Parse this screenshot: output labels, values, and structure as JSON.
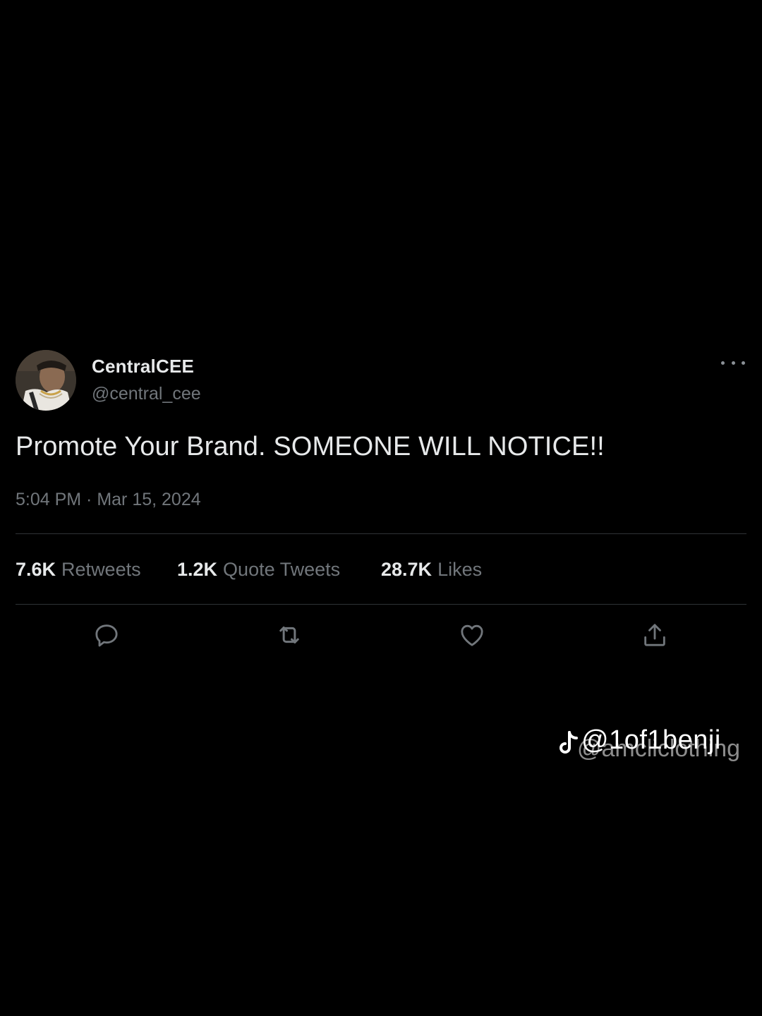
{
  "tweet": {
    "display_name": "CentralCEE",
    "handle": "@central_cee",
    "text": "Promote Your Brand. SOMEONE WILL NOTICE!!",
    "timestamp": "5:04 PM · Mar 15, 2024",
    "stats": {
      "retweets_count": "7.6K",
      "retweets_label": "Retweets",
      "quotes_count": "1.2K",
      "quotes_label": "Quote Tweets",
      "likes_count": "28.7K",
      "likes_label": "Likes"
    },
    "actions": {
      "reply_icon": "speech-bubble-icon",
      "retweet_icon": "retweet-arrows-icon",
      "like_icon": "heart-icon",
      "share_icon": "share-upload-icon"
    },
    "more_icon": "ellipsis-icon"
  },
  "watermark": {
    "primary": "@1of1benji",
    "secondary": "@amcliclothing",
    "logo_icon": "tiktok-logo-icon"
  },
  "colors": {
    "background": "#000000",
    "primary_text": "#e7e9ea",
    "secondary_text": "#71767b",
    "divider": "#2f3336"
  }
}
